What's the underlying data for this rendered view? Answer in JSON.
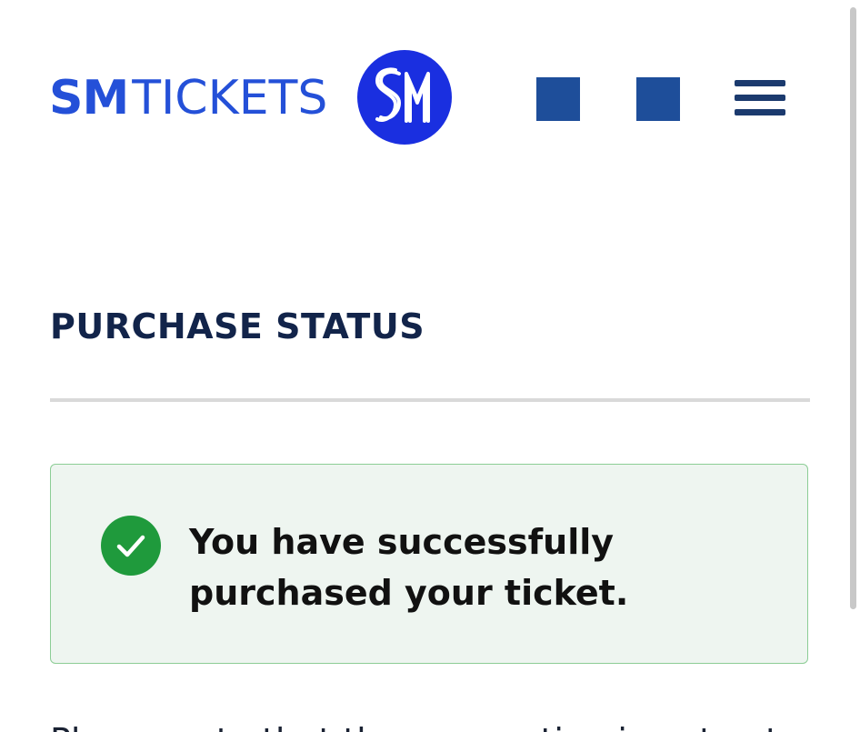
{
  "header": {
    "brand_bold": "SM",
    "brand_light": "TICKETS",
    "logo_icon": "sm-circle-logo",
    "button_icons": [
      "square-icon",
      "square-icon"
    ],
    "menu_icon": "hamburger-menu-icon"
  },
  "main": {
    "title": "PURCHASE STATUS",
    "alert": {
      "icon": "check-circle-icon",
      "message": "You have successfully purchased your ticket."
    },
    "body_text": "Please note that the reservation is not yet complete"
  },
  "colors": {
    "brand_blue": "#2450d8",
    "logo_blue": "#1a2fe0",
    "header_button": "#1e4e9a",
    "menu": "#1b3a6e",
    "title": "#12244a",
    "alert_bg": "#eef5f0",
    "alert_border": "#8ccd95",
    "success_green": "#1f9a3c"
  }
}
